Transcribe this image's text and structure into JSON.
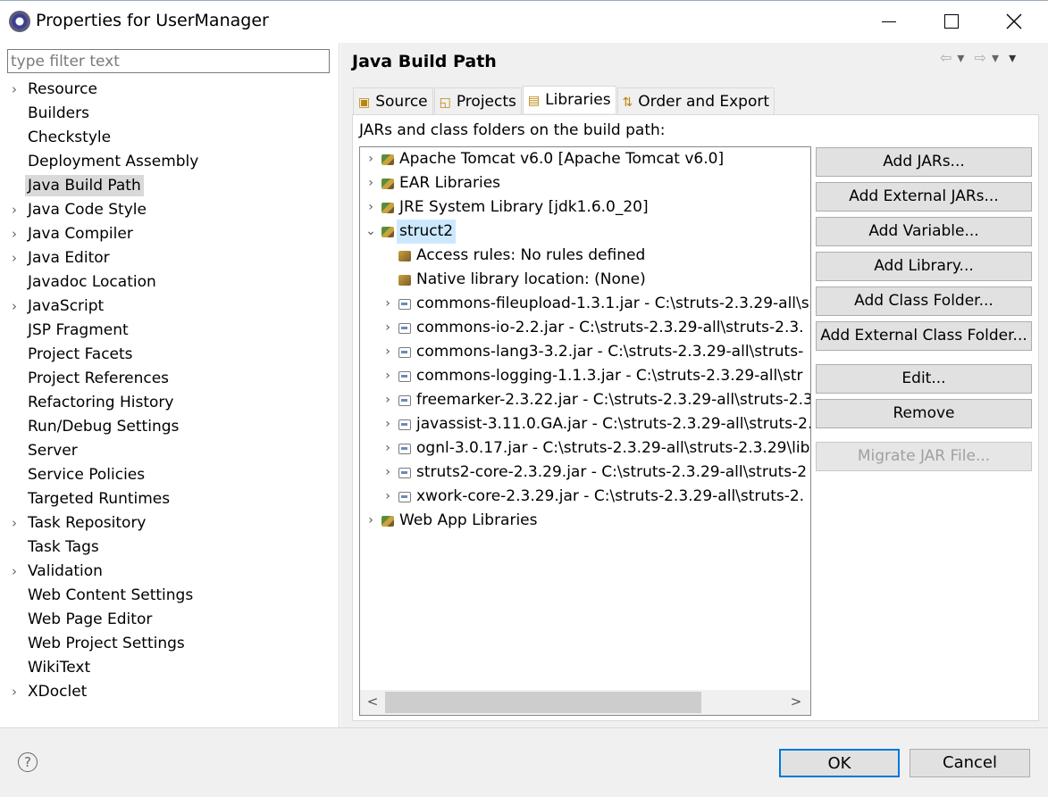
{
  "window": {
    "title": "Properties for UserManager"
  },
  "filter": {
    "placeholder": "type filter text"
  },
  "nav": {
    "items": [
      {
        "label": "Resource",
        "expandable": true
      },
      {
        "label": "Builders",
        "expandable": false
      },
      {
        "label": "Checkstyle",
        "expandable": false
      },
      {
        "label": "Deployment Assembly",
        "expandable": false
      },
      {
        "label": "Java Build Path",
        "expandable": false,
        "selected": true
      },
      {
        "label": "Java Code Style",
        "expandable": true
      },
      {
        "label": "Java Compiler",
        "expandable": true
      },
      {
        "label": "Java Editor",
        "expandable": true
      },
      {
        "label": "Javadoc Location",
        "expandable": false
      },
      {
        "label": "JavaScript",
        "expandable": true
      },
      {
        "label": "JSP Fragment",
        "expandable": false
      },
      {
        "label": "Project Facets",
        "expandable": false
      },
      {
        "label": "Project References",
        "expandable": false
      },
      {
        "label": "Refactoring History",
        "expandable": false
      },
      {
        "label": "Run/Debug Settings",
        "expandable": false
      },
      {
        "label": "Server",
        "expandable": false
      },
      {
        "label": "Service Policies",
        "expandable": false
      },
      {
        "label": "Targeted Runtimes",
        "expandable": false
      },
      {
        "label": "Task Repository",
        "expandable": true
      },
      {
        "label": "Task Tags",
        "expandable": false
      },
      {
        "label": "Validation",
        "expandable": true
      },
      {
        "label": "Web Content Settings",
        "expandable": false
      },
      {
        "label": "Web Page Editor",
        "expandable": false
      },
      {
        "label": "Web Project Settings",
        "expandable": false
      },
      {
        "label": "WikiText",
        "expandable": false
      },
      {
        "label": "XDoclet",
        "expandable": true
      }
    ]
  },
  "page": {
    "title": "Java Build Path",
    "tabs": [
      {
        "label": "Source",
        "active": false
      },
      {
        "label": "Projects",
        "active": false
      },
      {
        "label": "Libraries",
        "active": true
      },
      {
        "label": "Order and Export",
        "active": false
      }
    ],
    "heading": "JARs and class folders on the build path:"
  },
  "tree": {
    "rows": [
      {
        "label": "Apache Tomcat v6.0 [Apache Tomcat v6.0]",
        "level": 0,
        "chevron": ">",
        "icon": "library-icon"
      },
      {
        "label": "EAR Libraries",
        "level": 0,
        "chevron": ">",
        "icon": "library-icon"
      },
      {
        "label": "JRE System Library [jdk1.6.0_20]",
        "level": 0,
        "chevron": ">",
        "icon": "library-icon"
      },
      {
        "label": "struct2",
        "level": 0,
        "chevron": "v",
        "icon": "library-icon",
        "selected": true
      },
      {
        "label": "Access rules: No rules defined",
        "level": 1,
        "chevron": "",
        "icon": "access-rules-icon"
      },
      {
        "label": "Native library location: (None)",
        "level": 1,
        "chevron": "",
        "icon": "native-library-icon"
      },
      {
        "label": "commons-fileupload-1.3.1.jar - C:\\struts-2.3.29-all\\s",
        "level": 1,
        "chevron": ">",
        "icon": "jar-icon"
      },
      {
        "label": "commons-io-2.2.jar - C:\\struts-2.3.29-all\\struts-2.3.",
        "level": 1,
        "chevron": ">",
        "icon": "jar-icon"
      },
      {
        "label": "commons-lang3-3.2.jar - C:\\struts-2.3.29-all\\struts-",
        "level": 1,
        "chevron": ">",
        "icon": "jar-icon"
      },
      {
        "label": "commons-logging-1.1.3.jar - C:\\struts-2.3.29-all\\str",
        "level": 1,
        "chevron": ">",
        "icon": "jar-icon"
      },
      {
        "label": "freemarker-2.3.22.jar - C:\\struts-2.3.29-all\\struts-2.3",
        "level": 1,
        "chevron": ">",
        "icon": "jar-icon"
      },
      {
        "label": "javassist-3.11.0.GA.jar - C:\\struts-2.3.29-all\\struts-2.",
        "level": 1,
        "chevron": ">",
        "icon": "jar-icon"
      },
      {
        "label": "ognl-3.0.17.jar - C:\\struts-2.3.29-all\\struts-2.3.29\\lib",
        "level": 1,
        "chevron": ">",
        "icon": "jar-icon"
      },
      {
        "label": "struts2-core-2.3.29.jar - C:\\struts-2.3.29-all\\struts-2",
        "level": 1,
        "chevron": ">",
        "icon": "jar-icon"
      },
      {
        "label": "xwork-core-2.3.29.jar - C:\\struts-2.3.29-all\\struts-2.",
        "level": 1,
        "chevron": ">",
        "icon": "jar-icon"
      },
      {
        "label": "Web App Libraries",
        "level": 0,
        "chevron": ">",
        "icon": "library-icon"
      }
    ]
  },
  "buttons": {
    "add_jars": "Add JARs...",
    "add_external_jars": "Add External JARs...",
    "add_variable": "Add Variable...",
    "add_library": "Add Library...",
    "add_class_folder": "Add Class Folder...",
    "add_external_class_folder": "Add External Class Folder...",
    "edit": "Edit...",
    "remove": "Remove",
    "migrate_jar": "Migrate JAR File..."
  },
  "dialog": {
    "ok": "OK",
    "cancel": "Cancel",
    "help": "?"
  },
  "colors": {
    "selection": "#cce8ff",
    "ok_border": "#0078d7",
    "nav_selected": "#d9d9d9"
  }
}
